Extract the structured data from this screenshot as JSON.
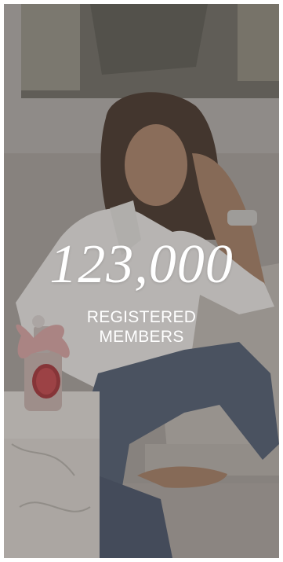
{
  "promo": {
    "count": "123,000",
    "label": "REGISTERED MEMBERS"
  },
  "photo": {
    "subject": "woman seated beside marble side table with perfume bottle"
  }
}
